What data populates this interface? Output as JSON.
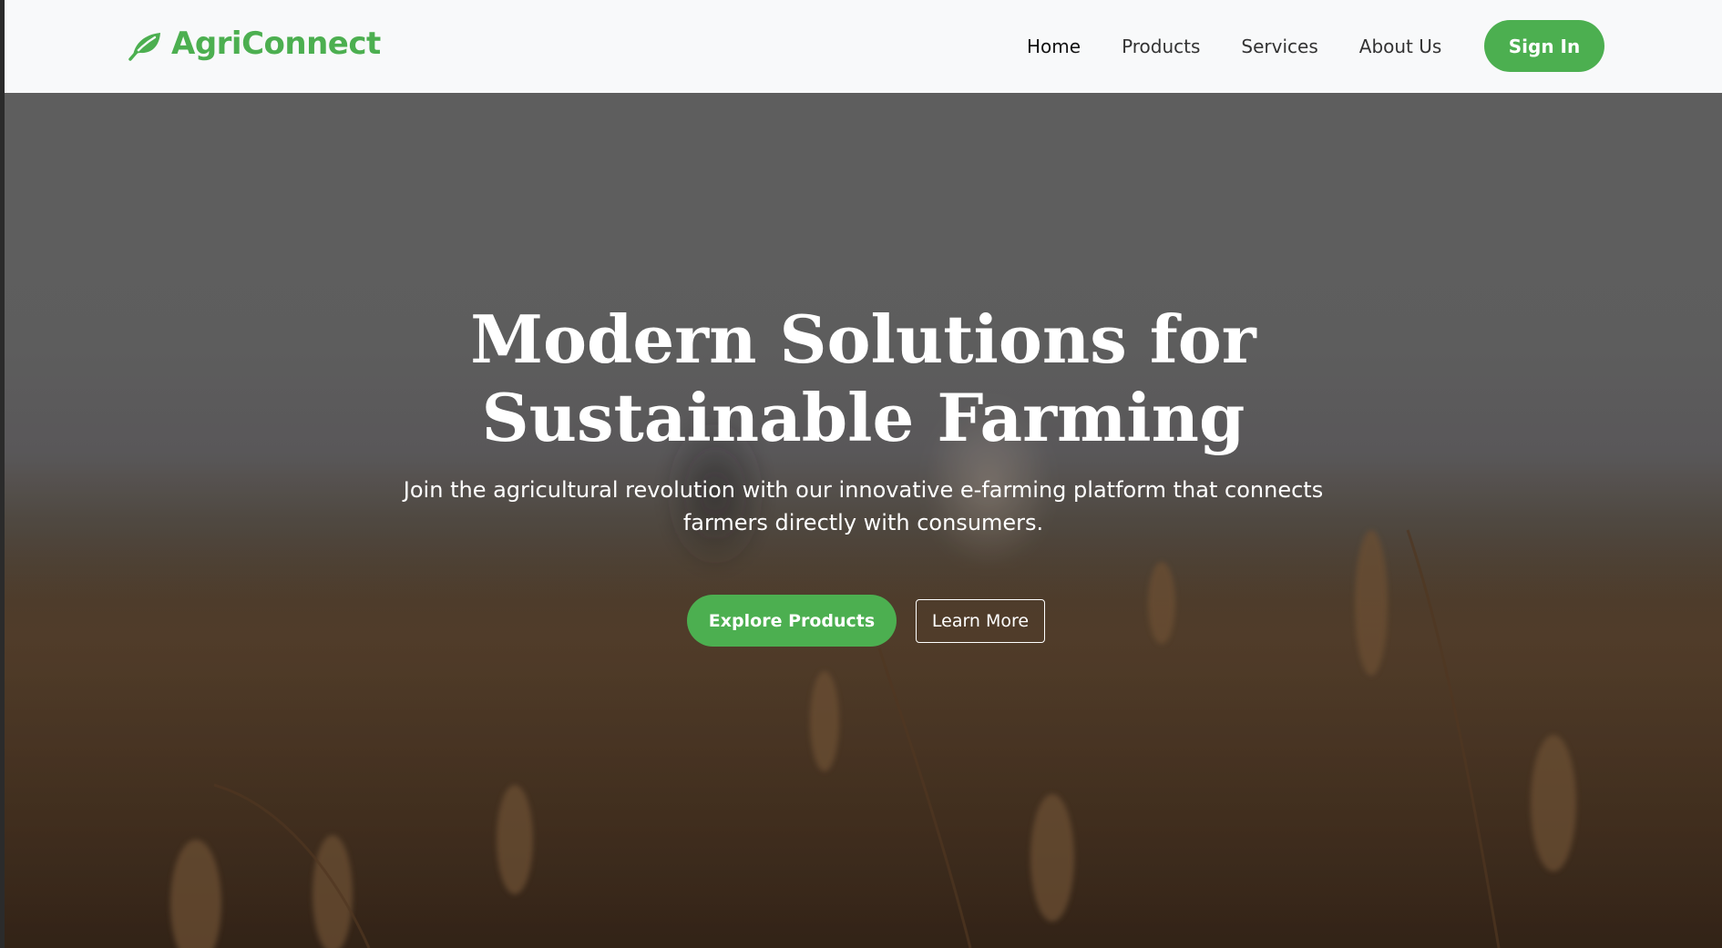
{
  "navbar": {
    "brand": {
      "name": "AgriConnect",
      "icon": "leaf-icon",
      "color": "#4caf50"
    },
    "links": [
      {
        "label": "Home",
        "active": true
      },
      {
        "label": "Products",
        "active": false
      },
      {
        "label": "Services",
        "active": false
      },
      {
        "label": "About Us",
        "active": false
      }
    ],
    "signin_label": "Sign In"
  },
  "hero": {
    "title_lines": [
      "Modern Solutions for",
      "Sustainable Farming"
    ],
    "subtitle_lines": [
      "Join the agricultural revolution with our innovative e-farming platform that connects",
      "farmers directly with consumers."
    ],
    "primary_button": "Explore Products",
    "secondary_button": "Learn More",
    "background": "wheat-field-photo"
  },
  "colors": {
    "accent": "#4caf50",
    "navbar_bg": "#f8f9fa",
    "hero_text": "#ffffff"
  }
}
